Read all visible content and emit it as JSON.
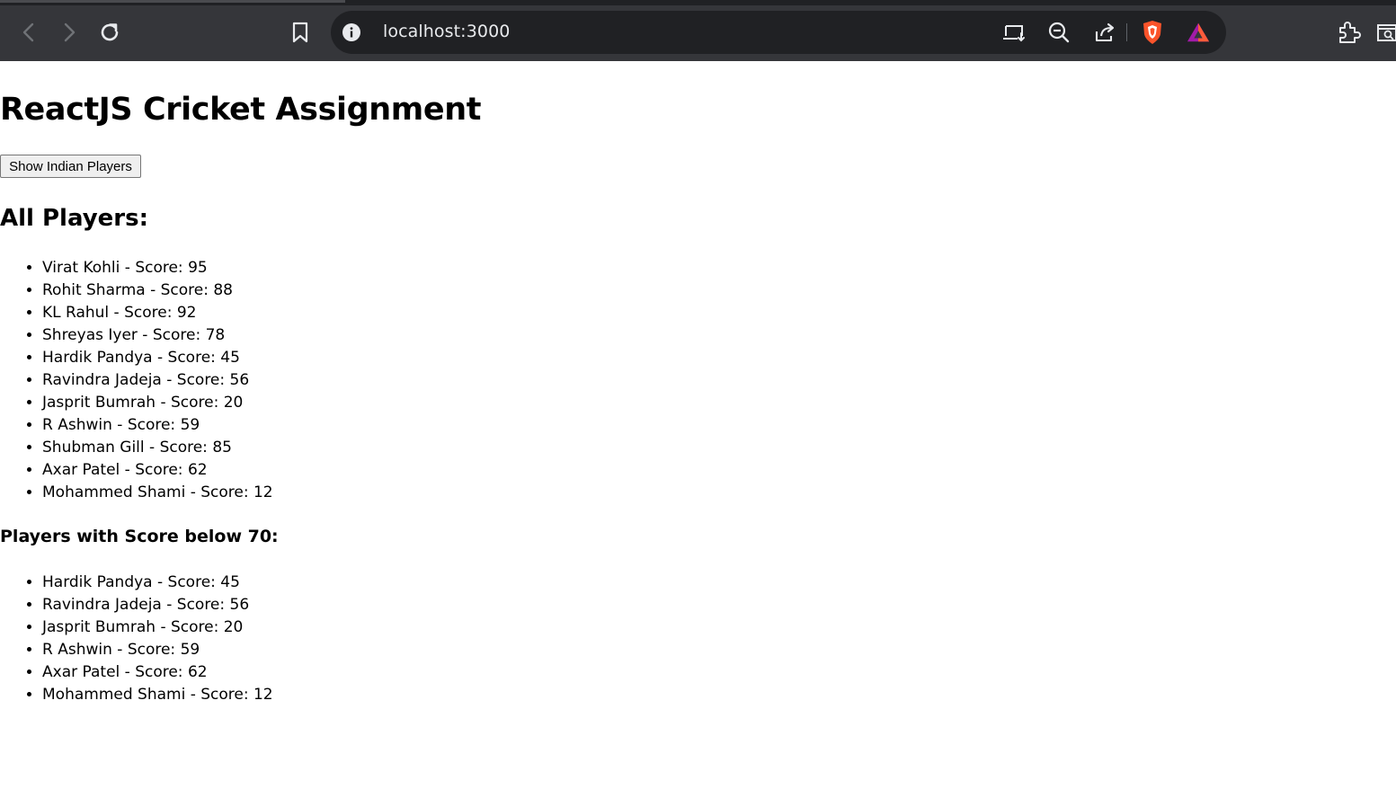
{
  "browser": {
    "url": "localhost:3000",
    "icons": [
      "back-icon",
      "forward-icon",
      "reload-icon",
      "bookmark-icon",
      "site-info-icon",
      "install-app-icon",
      "zoom-out-icon",
      "share-icon",
      "brave-shields-icon",
      "brave-rewards-icon",
      "extensions-icon",
      "reading-list-icon"
    ],
    "colors": {
      "toolbar": "#35363a",
      "omnibox": "#202124",
      "brave_orange": "#fb542b"
    }
  },
  "page": {
    "title": "ReactJS Cricket Assignment",
    "show_button_label": "Show Indian Players",
    "all_heading": "All Players:",
    "low_heading": "Players with Score below 70:",
    "all_players": [
      "Virat Kohli - Score: 95",
      "Rohit Sharma - Score: 88",
      "KL Rahul - Score: 92",
      "Shreyas Iyer - Score: 78",
      "Hardik Pandya - Score: 45",
      "Ravindra Jadeja - Score: 56",
      "Jasprit Bumrah - Score: 20",
      "R Ashwin - Score: 59",
      "Shubman Gill - Score: 85",
      "Axar Patel - Score: 62",
      "Mohammed Shami - Score: 12"
    ],
    "low_players": [
      "Hardik Pandya - Score: 45",
      "Ravindra Jadeja - Score: 56",
      "Jasprit Bumrah - Score: 20",
      "R Ashwin - Score: 59",
      "Axar Patel - Score: 62",
      "Mohammed Shami - Score: 12"
    ]
  }
}
